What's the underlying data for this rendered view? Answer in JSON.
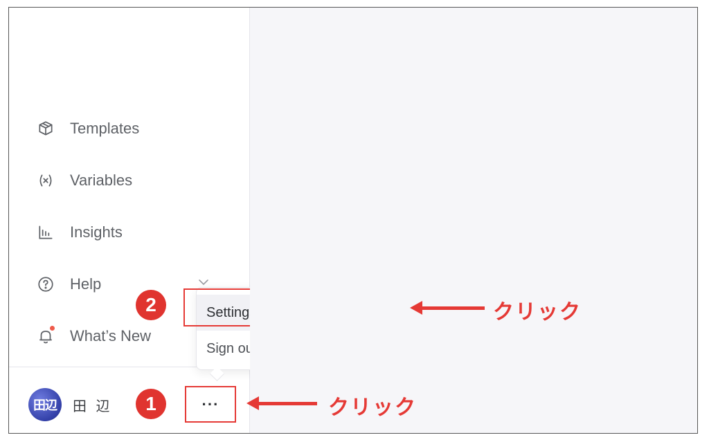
{
  "sidebar": {
    "items": [
      {
        "label": "Templates",
        "icon": "templates-icon"
      },
      {
        "label": "Variables",
        "icon": "variables-icon"
      },
      {
        "label": "Insights",
        "icon": "insights-icon"
      },
      {
        "label": "Help",
        "icon": "help-icon"
      },
      {
        "label": "What’s New",
        "icon": "bell-icon"
      }
    ]
  },
  "user": {
    "avatar_text": "田辺",
    "name": "田 辺"
  },
  "more_button": {
    "label": "···"
  },
  "menu": {
    "items": [
      {
        "label": "Settings"
      },
      {
        "label": "Sign out"
      }
    ]
  },
  "annotations": {
    "step1": "1",
    "step2": "2",
    "click_label_1": "クリック",
    "click_label_2": "クリック"
  },
  "colors": {
    "annotation_red": "#e53935",
    "notification_dot": "#ef5a4a",
    "avatar": "#3340a8"
  }
}
